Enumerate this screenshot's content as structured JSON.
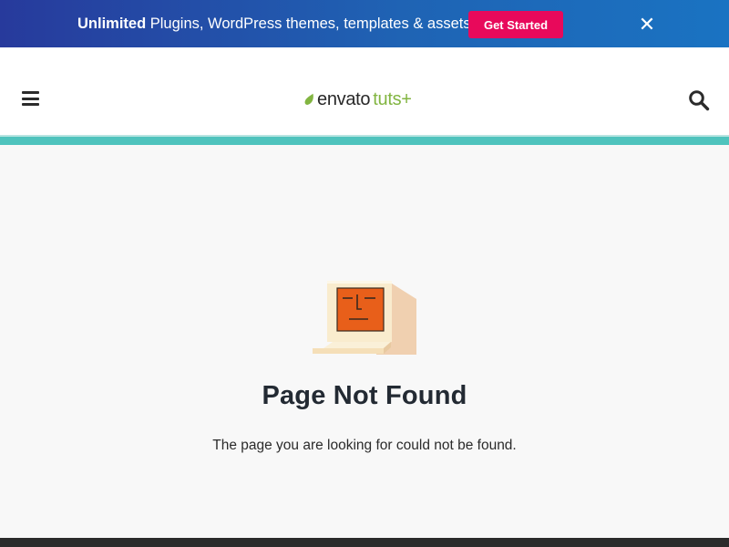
{
  "promo": {
    "highlight": "Unlimited",
    "text": " Plugins, WordPress themes, templates & assets!",
    "cta_label": "Get Started",
    "close_glyph": "✕"
  },
  "header": {
    "logo_primary": "envato",
    "logo_secondary": "tuts+"
  },
  "main": {
    "title": "Page Not Found",
    "message": "The page you are looking for could not be found."
  },
  "colors": {
    "banner_gradient_start": "#273a9c",
    "banner_gradient_end": "#1a73c2",
    "cta": "#e8095b",
    "accent_bar": "#4fc3bd",
    "logo_green": "#82b541",
    "screen_orange": "#e85f1a"
  }
}
